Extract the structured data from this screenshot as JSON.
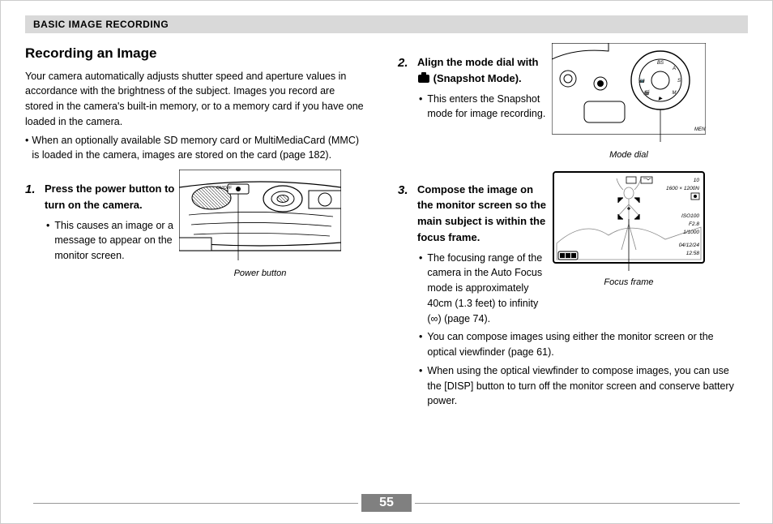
{
  "header": "BASIC IMAGE RECORDING",
  "section_title": "Recording an Image",
  "intro": "Your camera automatically adjusts shutter speed and aperture values in accordance with the brightness of the subject. Images you record are stored in the camera's built-in memory, or to a memory card if you have one loaded in the camera.",
  "intro_bullet": "When an optionally available SD memory card or MultiMediaCard (MMC) is loaded in the camera, images are stored on the card (page 182).",
  "steps": {
    "one": {
      "num": "1.",
      "title": "Press the power button to turn on the camera.",
      "sub1": "This causes an image or a message to appear on the monitor screen.",
      "caption": "Power button"
    },
    "two": {
      "num": "2.",
      "title_a": "Align the mode dial with ",
      "title_b": " (Snapshot Mode).",
      "sub1": "This enters the Snapshot mode for image recording.",
      "caption": "Mode dial"
    },
    "three": {
      "num": "3.",
      "title": "Compose the image on the monitor screen so the main subject is within the focus frame.",
      "sub1": "The focusing range of the camera in the Auto Focus mode is approximately 40cm (1.3 feet) to infinity (∞) (page 74).",
      "sub2": "You can compose images using either the monitor screen or the optical viewfinder (page 61).",
      "sub3": "When using the optical viewfinder to compose images, you can use the [DISP] button to turn off the monitor screen and conserve battery power.",
      "caption": "Focus frame"
    }
  },
  "screen": {
    "res": "1600 × 1200N",
    "count": "10",
    "iso": "ISO100",
    "f": "F2.8",
    "shutter": "1/1000",
    "date": "04/12/24",
    "time": "12:58"
  },
  "page_number": "55"
}
